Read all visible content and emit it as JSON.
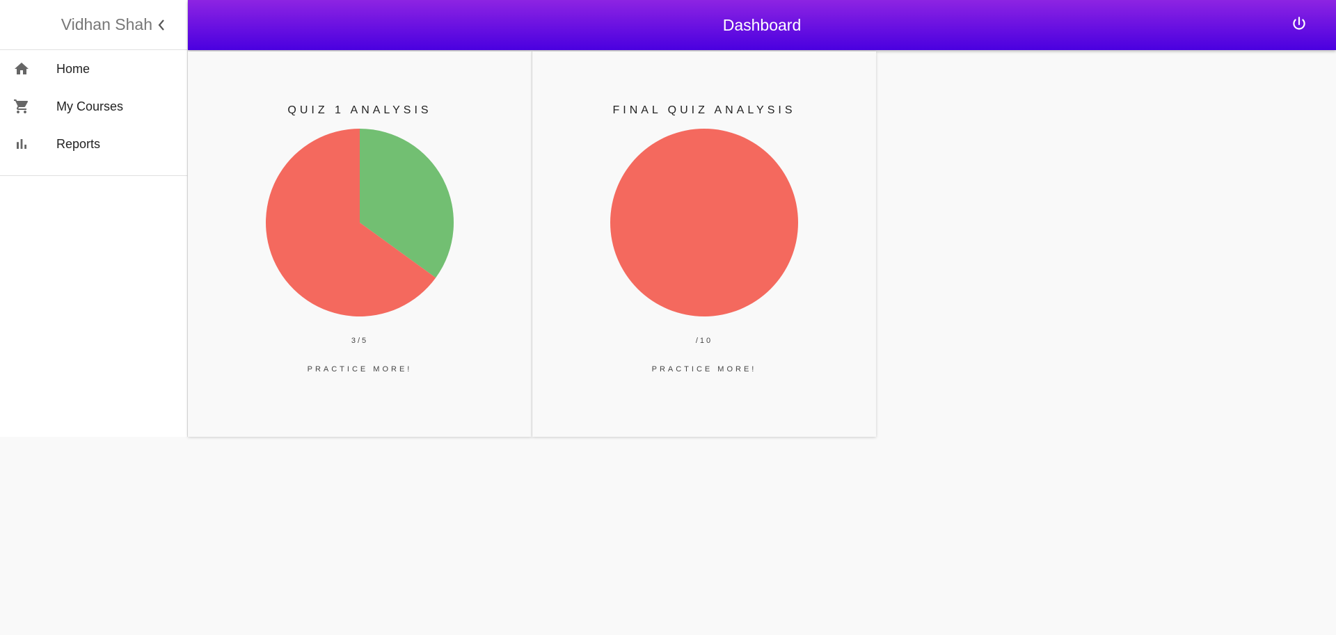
{
  "sidebar": {
    "user_name": "Vidhan Shah",
    "items": [
      {
        "label": "Home",
        "icon": "home-icon"
      },
      {
        "label": "My Courses",
        "icon": "cart-icon"
      },
      {
        "label": "Reports",
        "icon": "bar-chart-icon"
      }
    ]
  },
  "header": {
    "title": "Dashboard",
    "gradient_top": "#8d24e2",
    "gradient_bottom": "#4a00e0"
  },
  "cards": [
    {
      "title": "QUIZ 1 ANALYSIS",
      "score": "3/5",
      "message": "PRACTICE MORE!"
    },
    {
      "title": "FINAL QUIZ ANALYSIS",
      "score": "/10",
      "message": "PRACTICE MORE!"
    }
  ],
  "chart_data": [
    {
      "type": "pie",
      "title": "QUIZ 1 ANALYSIS",
      "categories": [
        "green",
        "red"
      ],
      "values": [
        0.35,
        0.65
      ],
      "colors": [
        "#72bf72",
        "#f4695e"
      ]
    },
    {
      "type": "pie",
      "title": "FINAL QUIZ ANALYSIS",
      "categories": [
        "red"
      ],
      "values": [
        1.0
      ],
      "colors": [
        "#f4695e"
      ]
    }
  ]
}
